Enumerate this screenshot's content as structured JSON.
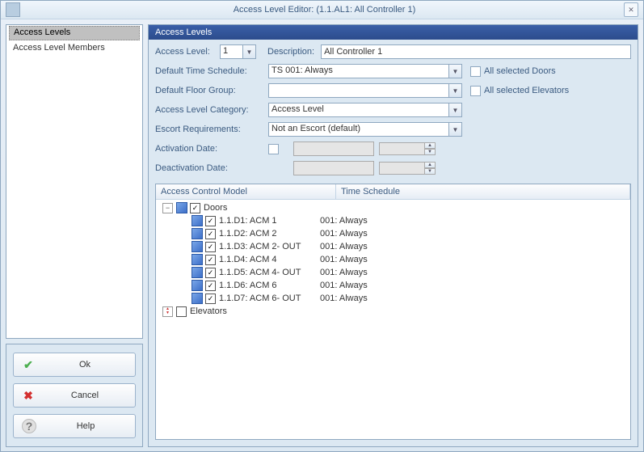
{
  "window": {
    "title": "Access Level Editor: (1.1.AL1: All Controller 1)"
  },
  "nav": {
    "items": [
      "Access Levels",
      "Access Level Members"
    ],
    "selected": "Access Levels"
  },
  "buttons": {
    "ok": "Ok",
    "cancel": "Cancel",
    "help": "Help"
  },
  "panel": {
    "header": "Access Levels",
    "access_level_label": "Access Level:",
    "access_level_value": "1",
    "description_label": "Description:",
    "description_value": "All Controller 1",
    "default_time_label": "Default Time Schedule:",
    "default_time_value": "TS 001:  Always",
    "all_doors_label": "All selected Doors",
    "default_floor_label": "Default Floor Group:",
    "default_floor_value": "",
    "all_elev_label": "All selected Elevators",
    "category_label": "Access Level Category:",
    "category_value": "Access Level",
    "escort_label": "Escort Requirements:",
    "escort_value": "Not an Escort (default)",
    "activation_label": "Activation Date:",
    "deactivation_label": "Deactivation Date:"
  },
  "list": {
    "col_model": "Access Control Model",
    "col_sched": "Time Schedule",
    "doors_label": "Doors",
    "elevators_label": "Elevators",
    "items": [
      {
        "name": "1.1.D1: ACM 1",
        "sched": "001:  Always"
      },
      {
        "name": "1.1.D2: ACM 2",
        "sched": "001:  Always"
      },
      {
        "name": "1.1.D3: ACM 2- OUT",
        "sched": "001:  Always"
      },
      {
        "name": "1.1.D4: ACM 4",
        "sched": "001:  Always"
      },
      {
        "name": "1.1.D5: ACM 4- OUT",
        "sched": "001:  Always"
      },
      {
        "name": "1.1.D6: ACM 6",
        "sched": "001:  Always"
      },
      {
        "name": "1.1.D7: ACM 6- OUT",
        "sched": "001:  Always"
      }
    ]
  }
}
